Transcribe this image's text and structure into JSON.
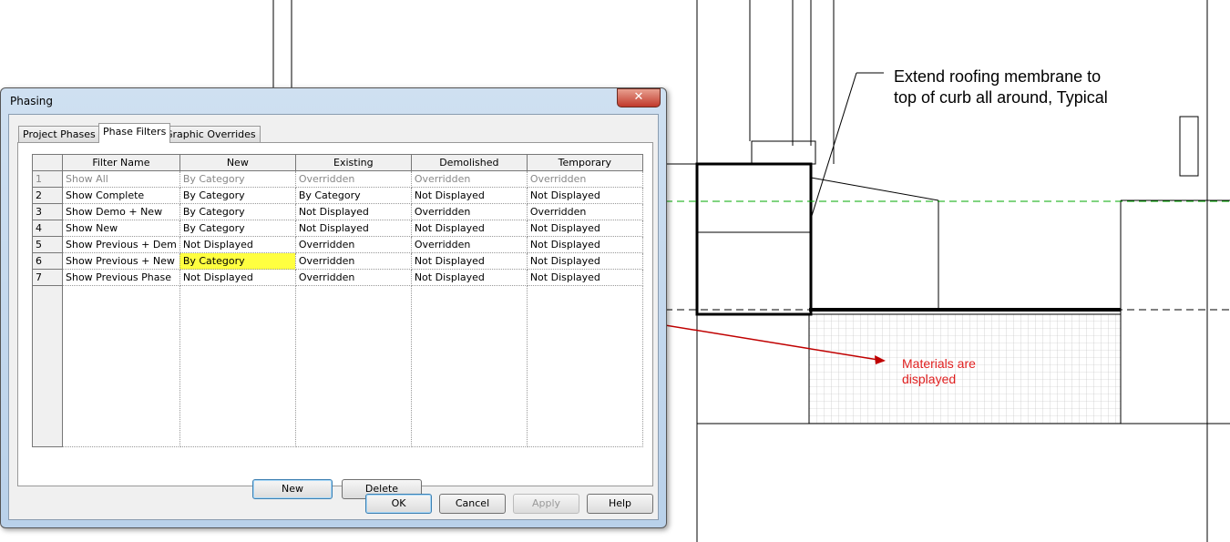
{
  "drawing": {
    "note": [
      "Extend roofing membrane to",
      "top of curb all around, Typical"
    ],
    "red_note": [
      "Materials are",
      "displayed"
    ]
  },
  "dialog": {
    "title": "Phasing",
    "close": "✕",
    "tabs": [
      "Project Phases",
      "Phase Filters",
      "Graphic Overrides"
    ],
    "active_tab": "Phase Filters",
    "columns": [
      "",
      "Filter Name",
      "New",
      "Existing",
      "Demolished",
      "Temporary"
    ],
    "rows": [
      [
        "1",
        "Show All",
        "By Category",
        "Overridden",
        "Overridden",
        "Overridden"
      ],
      [
        "2",
        "Show Complete",
        "By Category",
        "By Category",
        "Not Displayed",
        "Not Displayed"
      ],
      [
        "3",
        "Show Demo + New",
        "By Category",
        "Not Displayed",
        "Overridden",
        "Overridden"
      ],
      [
        "4",
        "Show New",
        "By Category",
        "Not Displayed",
        "Not Displayed",
        "Not Displayed"
      ],
      [
        "5",
        "Show Previous + Dem",
        "Not Displayed",
        "Overridden",
        "Overridden",
        "Not Displayed"
      ],
      [
        "6",
        "Show Previous + New",
        "By Category",
        "Overridden",
        "Not Displayed",
        "Not Displayed"
      ],
      [
        "7",
        "Show Previous Phase",
        "Not Displayed",
        "Overridden",
        "Not Displayed",
        "Not Displayed"
      ]
    ],
    "buttons": {
      "new": "New",
      "delete": "Delete",
      "ok": "OK",
      "cancel": "Cancel",
      "apply": "Apply",
      "help": "Help"
    }
  }
}
